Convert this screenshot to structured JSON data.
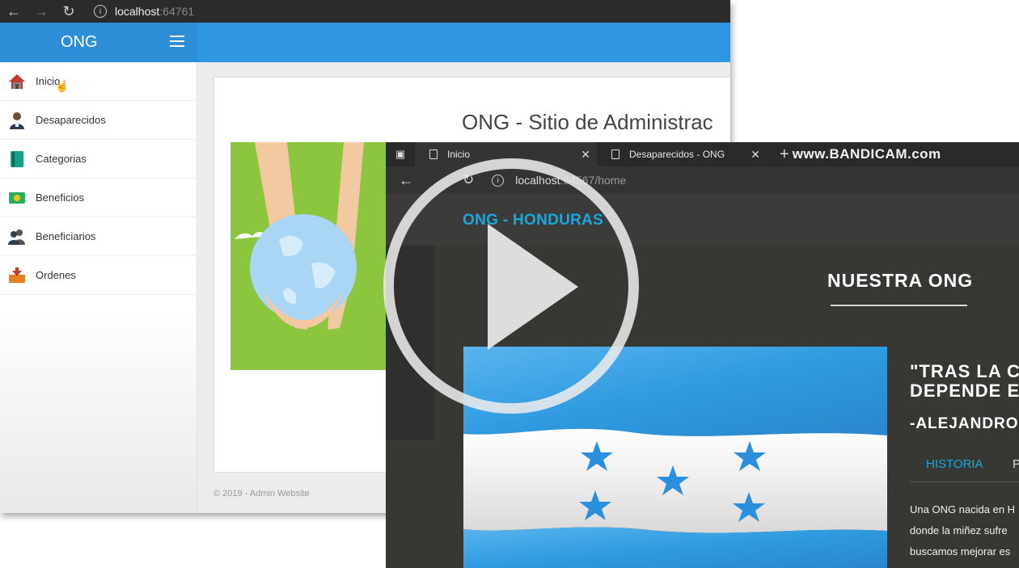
{
  "back_window": {
    "url_host": "localhost",
    "url_port": ":64761",
    "brand": "ONG",
    "menu": [
      {
        "label": "Inicio",
        "icon": "home-icon"
      },
      {
        "label": "Desaparecidos",
        "icon": "person-icon"
      },
      {
        "label": "Categorias",
        "icon": "book-icon"
      },
      {
        "label": "Beneficios",
        "icon": "money-icon"
      },
      {
        "label": "Beneficiarios",
        "icon": "users-icon"
      },
      {
        "label": "Ordenes",
        "icon": "inbox-icon"
      }
    ],
    "page_title": "ONG - Sitio de Administrac",
    "footer": "© 2019 - Admin Website"
  },
  "front_window": {
    "tabs": [
      {
        "label": "Inicio"
      },
      {
        "label": "Desaparecidos - ONG"
      }
    ],
    "watermark": "www.BANDICAM.com",
    "url_host": "localhost",
    "url_rest": ":64567/home",
    "site_logo": "ONG - HONDURAS",
    "section_title": "NUESTRA ONG",
    "quote_line1": "\"TRAS LA C",
    "quote_line2": "DEPENDE E",
    "author": "-ALEJANDRO",
    "content_tabs": [
      {
        "label": "HISTORIA"
      },
      {
        "label": "P"
      }
    ],
    "body_lines": [
      "Una ONG nacida en H",
      "donde la miñez sufre",
      "buscamos mejorar es"
    ]
  },
  "colors": {
    "topbar": "#2f96e0",
    "front_bg": "#373733",
    "accent_blue": "#1aa7e0",
    "flag_blue": "#2f9be0"
  }
}
